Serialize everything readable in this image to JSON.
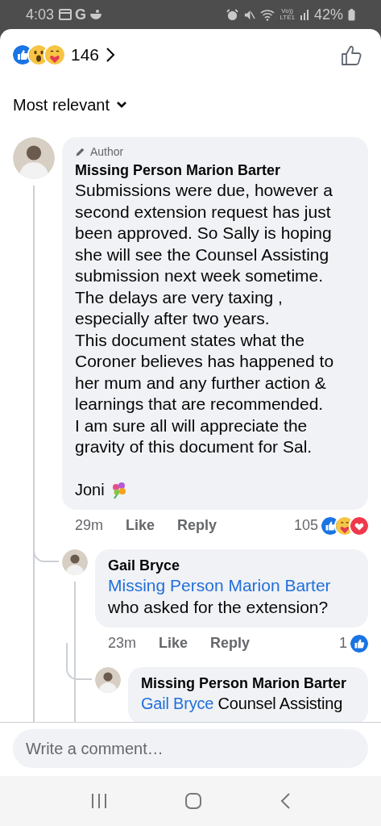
{
  "status_bar": {
    "time": "4:03",
    "notification_letter": "G",
    "network_top": "Vo))",
    "network_bottom": "LTE1",
    "battery": "42%"
  },
  "reactions_summary": {
    "reactions": [
      {
        "kind": "like"
      },
      {
        "kind": "wow"
      },
      {
        "kind": "care"
      }
    ],
    "count": "146"
  },
  "sort": {
    "label": "Most relevant"
  },
  "comments": [
    {
      "badge": "Author",
      "author": "Missing Person Marion Barter",
      "paragraphs": [
        "Submissions were due, however a second extension request has just been approved. So Sally is hoping she will see the Counsel Assisting submission next week sometime. The delays are very taxing , especially after two years.",
        "This document states what the Coroner believes has happened to her mum and any further action & learnings that are recommended.",
        "I am sure all will appreciate the gravity of this document for Sal."
      ],
      "signature": "Joni",
      "time": "29m",
      "actions": [
        "Like",
        "Reply"
      ],
      "reaction_count": "105",
      "reactions": [
        {
          "kind": "like"
        },
        {
          "kind": "care"
        },
        {
          "kind": "love"
        }
      ],
      "children": [
        {
          "author": "Gail Bryce",
          "mention": "Missing Person Marion Barter",
          "text": "who asked for the extension?",
          "time": "23m",
          "actions": [
            "Like",
            "Reply"
          ],
          "reaction_count": "1",
          "reactions": [
            {
              "kind": "like"
            }
          ],
          "children": [
            {
              "author": "Missing Person Marion Barter",
              "mention": "Gail Bryce",
              "text": "Counsel Assisting"
            }
          ]
        }
      ]
    }
  ],
  "composer": {
    "placeholder": "Write a comment…"
  }
}
